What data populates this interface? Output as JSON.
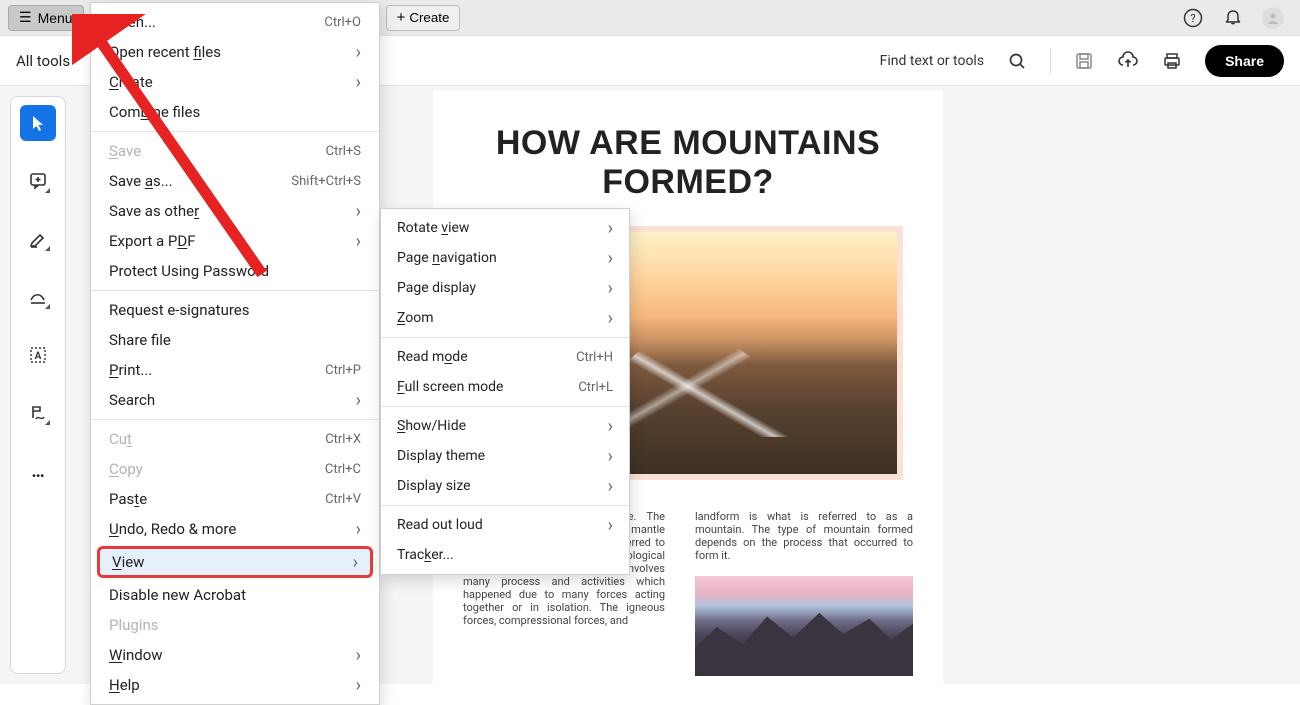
{
  "topbar": {
    "menu_label": "Menu",
    "create_label": "Create"
  },
  "subbar": {
    "all_tools_label": "All tools",
    "find_label": "Find text or tools",
    "share_label": "Share"
  },
  "document": {
    "title": "HOW ARE MOUNTAINS FORMED?",
    "col1": "ed as a result 's lithosphere. The lithosphere consists of the outer mantle and the crust which are also referred to as tectonic plates. The geological process of mountain formation involves many process and activities which happened due to many forces acting together or in isolation. The igneous forces, compressional forces, and",
    "col2": "landform is what is referred to as a mountain. The type of mountain formed depends on the process that occurred to form it."
  },
  "menu": {
    "open": "Open...",
    "open_shortcut": "Ctrl+O",
    "open_recent": "Open recent files",
    "create": "Create",
    "combine": "Combine files",
    "save": "Save",
    "save_shortcut": "Ctrl+S",
    "save_as": "Save as...",
    "save_as_shortcut": "Shift+Ctrl+S",
    "save_other": "Save as other",
    "export_pdf": "Export a PDF",
    "protect": "Protect Using Password",
    "esign": "Request e-signatures",
    "share_file": "Share file",
    "print": "Print...",
    "print_shortcut": "Ctrl+P",
    "search": "Search",
    "cut": "Cut",
    "cut_shortcut": "Ctrl+X",
    "copy": "Copy",
    "copy_shortcut": "Ctrl+C",
    "paste": "Paste",
    "paste_shortcut": "Ctrl+V",
    "undo_redo": "Undo, Redo & more",
    "view": "View",
    "disable_new": "Disable new Acrobat",
    "plugins": "Plugins",
    "window": "Window",
    "help": "Help"
  },
  "submenu": {
    "rotate_view": "Rotate view",
    "page_nav": "Page navigation",
    "page_display": "Page display",
    "zoom": "Zoom",
    "read_mode": "Read mode",
    "read_mode_shortcut": "Ctrl+H",
    "full_screen": "Full screen mode",
    "full_screen_shortcut": "Ctrl+L",
    "show_hide": "Show/Hide",
    "display_theme": "Display theme",
    "display_size": "Display size",
    "read_out": "Read out loud",
    "tracker": "Tracker..."
  }
}
